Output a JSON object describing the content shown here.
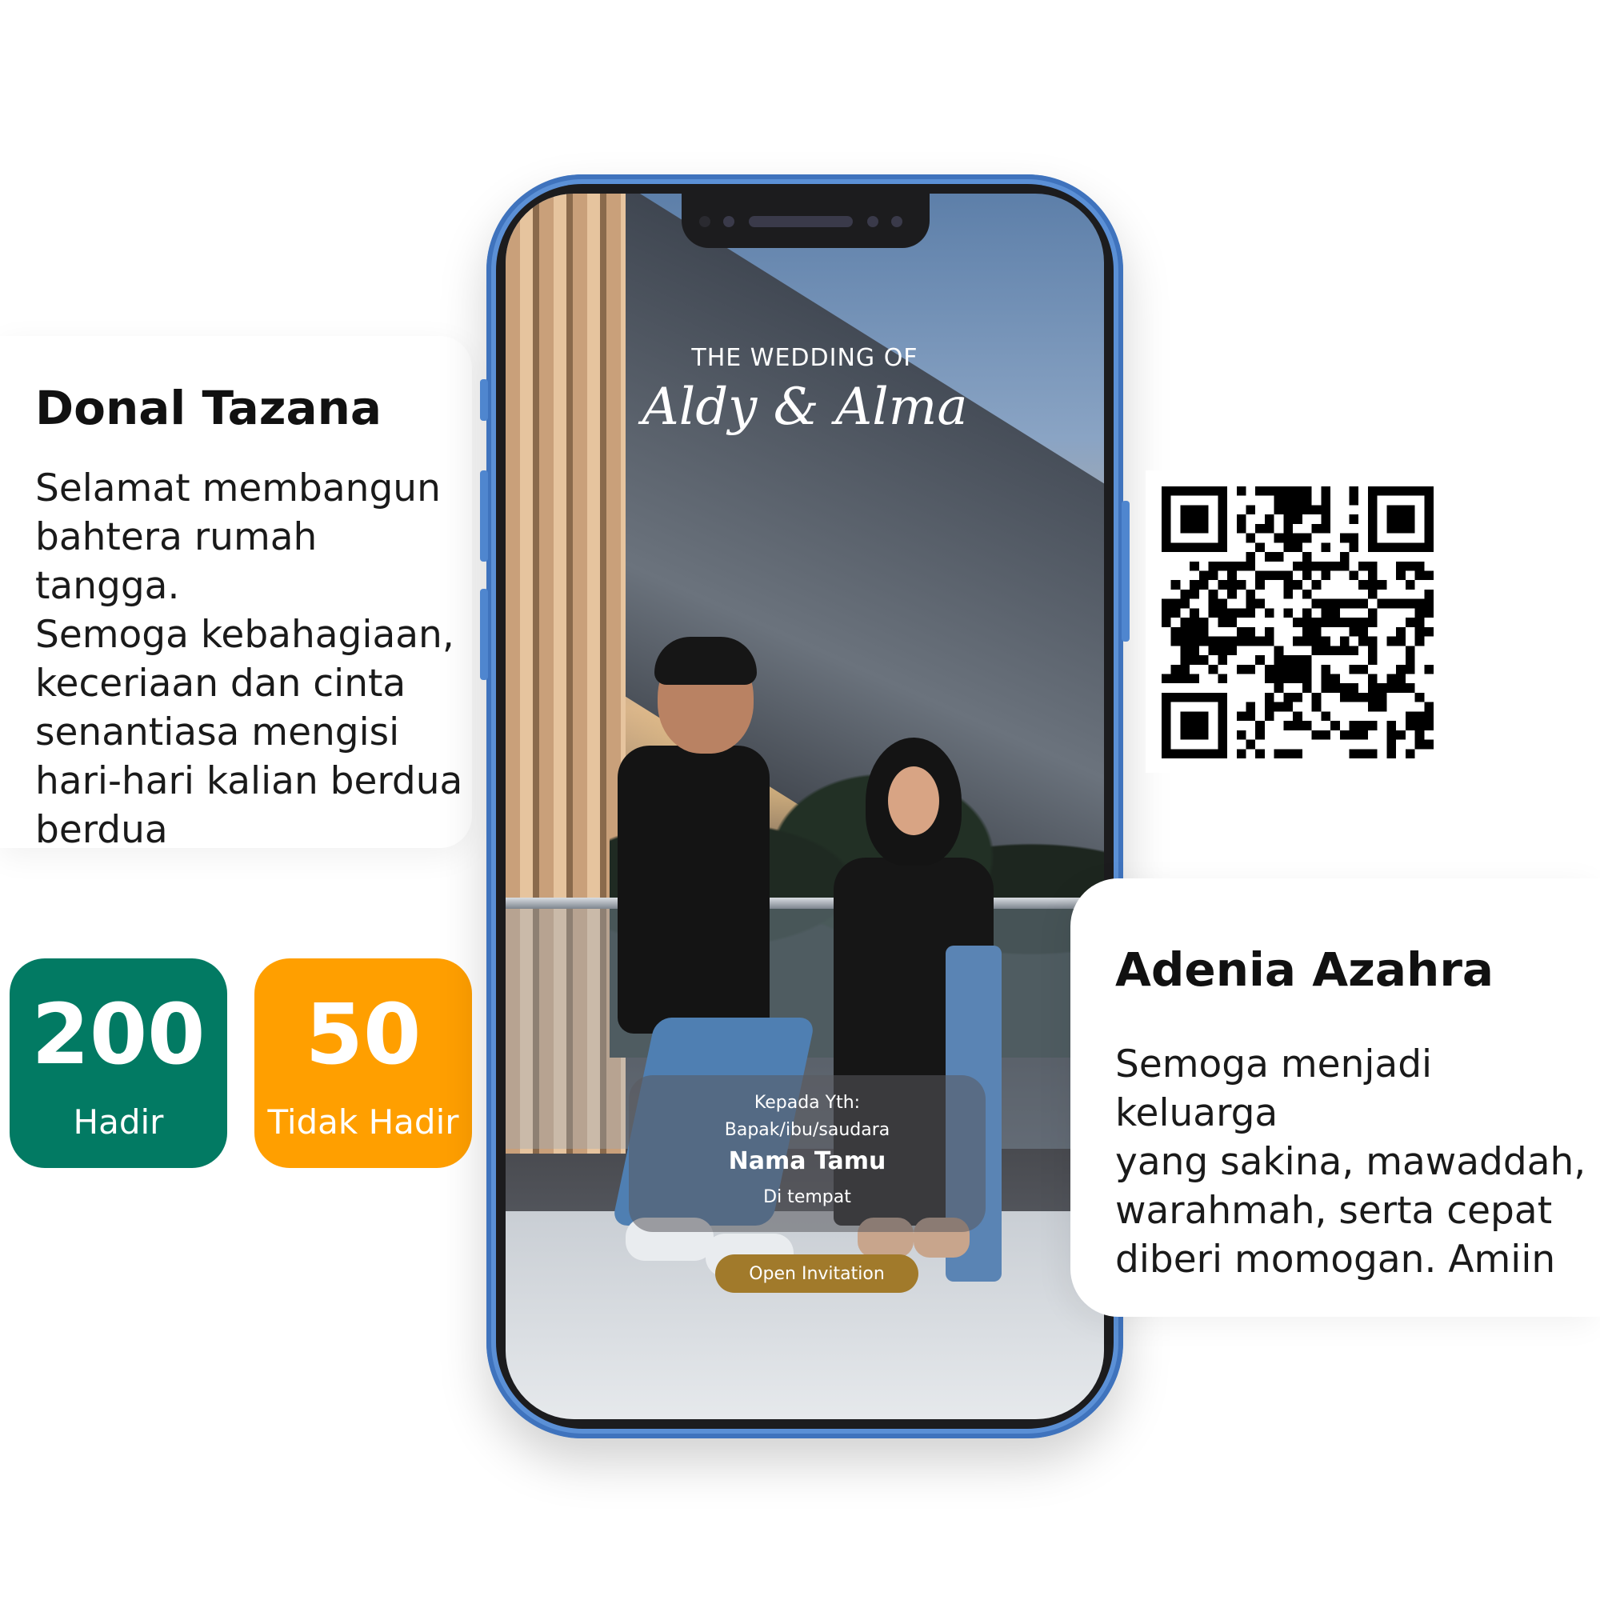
{
  "wishes": [
    {
      "name": "Donal Tazana",
      "lines": [
        "Selamat membangun",
        "bahtera rumah tangga.",
        "Semoga kebahagiaan,",
        "keceriaan dan cinta",
        "senantiasa mengisi",
        "hari-hari kalian berdua",
        "berdua"
      ]
    },
    {
      "name": "Adenia Azahra",
      "lines": [
        "Semoga menjadi keluarga",
        "yang sakina, mawaddah,",
        "warahmah, serta cepat",
        "diberi momogan. Amiin"
      ]
    }
  ],
  "stats": {
    "hadir": {
      "count": "200",
      "label": "Hadir",
      "color": "#027a63"
    },
    "tidak_hadir": {
      "count": "50",
      "label": "Tidak Hadir",
      "color": "#ff9f00"
    }
  },
  "invitation": {
    "heading": "THE WEDDING OF",
    "couple": "Aldy & Alma",
    "to_line": "Kepada Yth:",
    "salutation": "Bapak/ibu/saudara",
    "guest_name": "Nama Tamu",
    "place": "Di tempat",
    "button_label": "Open Invitation",
    "button_color": "#a17a2b"
  },
  "phone": {
    "frame_color": "#5b90d6"
  }
}
